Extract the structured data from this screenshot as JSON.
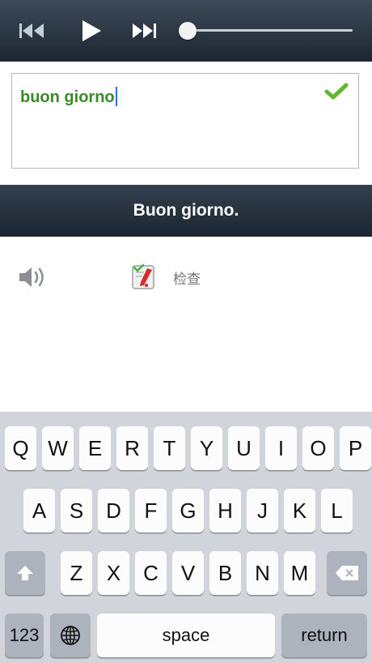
{
  "player": {
    "prev_icon": "skip-back-icon",
    "play_icon": "play-icon",
    "next_icon": "skip-forward-icon",
    "progress": 0.0
  },
  "answer": {
    "text": "buon giorno",
    "status_icon": "checkmark-icon",
    "status_color": "#5fb830"
  },
  "phrase": {
    "text": "Buon giorno."
  },
  "actions": {
    "speaker_icon": "speaker-icon",
    "check_label": "检查"
  },
  "keyboard": {
    "row1": [
      "Q",
      "W",
      "E",
      "R",
      "T",
      "Y",
      "U",
      "I",
      "O",
      "P"
    ],
    "row2": [
      "A",
      "S",
      "D",
      "F",
      "G",
      "H",
      "J",
      "K",
      "L"
    ],
    "row3": [
      "Z",
      "X",
      "C",
      "V",
      "B",
      "N",
      "M"
    ],
    "numbers_label": "123",
    "space_label": "space",
    "return_label": "return"
  },
  "colors": {
    "bar_dark": "#1d2733",
    "answer_text": "#3b8a2a",
    "keyboard_bg": "#d1d5db"
  }
}
